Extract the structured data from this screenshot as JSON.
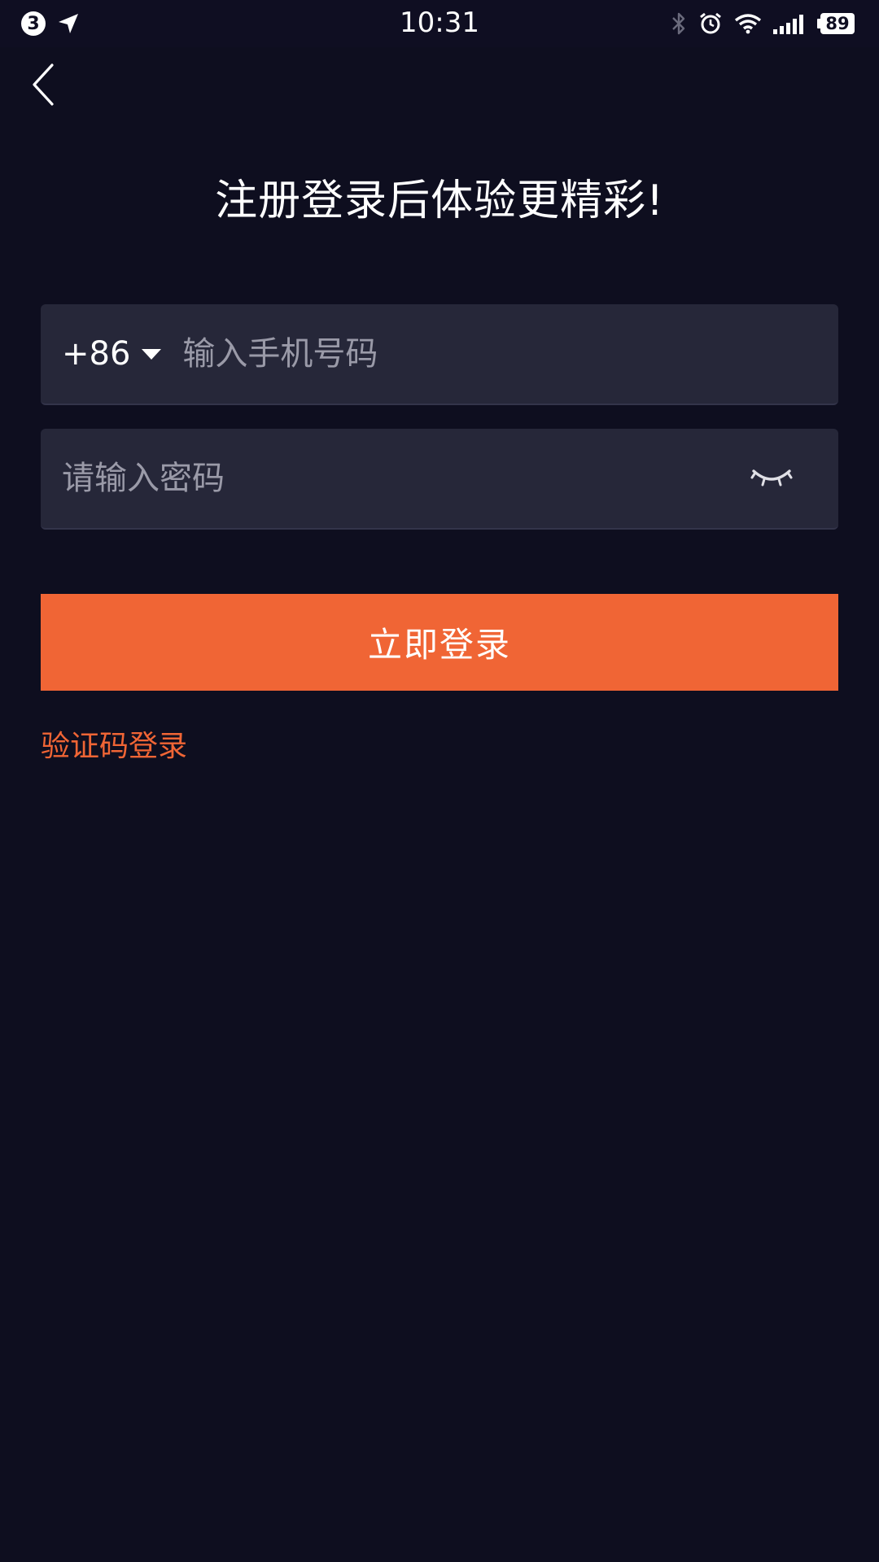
{
  "status_bar": {
    "notification_count": "3",
    "time": "10:31",
    "battery_level": "89",
    "icons": [
      "location-arrow-icon",
      "bluetooth-icon",
      "alarm-icon",
      "wifi-icon",
      "signal-icon",
      "battery-icon"
    ]
  },
  "header": {
    "back_icon": "chevron-left-icon",
    "title": "注册登录后体验更精彩!"
  },
  "form": {
    "phone": {
      "country_code": "+86",
      "placeholder": "输入手机号码",
      "value": ""
    },
    "password": {
      "placeholder": "请输入密码",
      "value": "",
      "toggle_icon": "eye-closed-icon"
    },
    "login_label": "立即登录",
    "sms_login_label": "验证码登录"
  },
  "colors": {
    "background": "#0e0e1f",
    "field_background": "#262739",
    "accent": "#f06535"
  }
}
